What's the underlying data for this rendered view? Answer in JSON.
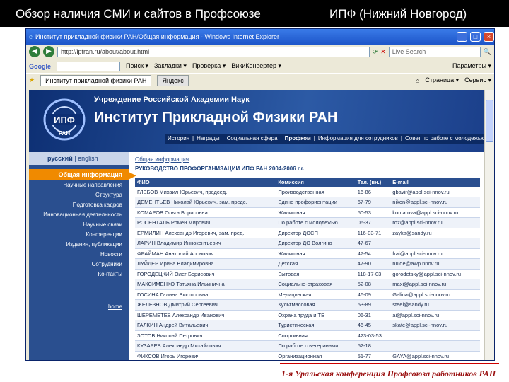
{
  "slide": {
    "title_left": "Обзор наличия СМИ и сайтов в Профсоюзе",
    "title_right": "ИПФ (Нижний Новгород)",
    "footer": "1-я Уральская конференция Профсоюза работников РАН"
  },
  "browser": {
    "window_title": "Институт прикладной физики РАН/Общая информация - Windows Internet Explorer",
    "url": "http://ipfran.ru/about/about.html",
    "live_search_placeholder": "Live Search",
    "google_label": "Google",
    "google_buttons": [
      "Поиск ▾",
      "Закладки ▾",
      "Проверка ▾",
      "ВикиКонвертер ▾"
    ],
    "settings_label": "Параметры ▾",
    "tabs": [
      "Институт прикладной физики РАН",
      "Яндекс"
    ],
    "tools": [
      "Страница ▾",
      "Сервис ▾"
    ]
  },
  "site": {
    "banner_sub": "Учреждение Российской Академии Наук",
    "banner_main": "Институт Прикладной Физики РАН",
    "top_menu": [
      "История",
      "Награды",
      "Социальная сфера",
      "Профком",
      "Информация для сотрудников",
      "Совет по работе с молодежью"
    ],
    "lang_ru": "русский",
    "lang_en": "english",
    "active_item": "Общая информация",
    "menu": [
      "Научные направления",
      "Структура",
      "Подготовка кадров",
      "Инновационная деятельность",
      "Научные связи",
      "Конференции",
      "Издания, публикации",
      "Новости",
      "Сотрудники",
      "Контакты"
    ],
    "home": "home",
    "breadcrumb": "Общая информация",
    "page_title": "РУКОВОДСТВО ПРОФОРГАНИЗАЦИИ ИПФ РАН 2004-2006 г.г.",
    "columns": [
      "ФИО",
      "Комиссия",
      "Тел. (вн.)",
      "E-mail"
    ],
    "rows": [
      [
        "ГЛЕБОВ Михаил Юрьевич, председ.",
        "Производственная",
        "16-86",
        "gbavir@appl.sci-nnov.ru"
      ],
      [
        "ДЕМЕНТЬЕВ Николай Юрьевич, зам. предс.",
        "Едино профориентации",
        "67-79",
        "nikon@appl.sci-nnov.ru"
      ],
      [
        "КОМАРОВ Ольга Борисовна",
        "Жилищная",
        "50-53",
        "komarova@appl.sci-nnov.ru"
      ],
      [
        "РОСЕНТАЛЬ Ромен Мирович",
        "По работе с молодежью",
        "06-37",
        "roz@appl.sci-nnov.ru"
      ],
      [
        "ЕРМИЛИН Александр Игоревич, зам. пред.",
        "Директор ДОСП",
        "116-03-71",
        "zayka@sandy.ru"
      ],
      [
        "ЛАРИН Владимир Иннокентьевич",
        "Директор ДО Волгино",
        "47-67",
        ""
      ],
      [
        "ФРАЙМАН Анатолий Аронович",
        "Жилищная",
        "47-54",
        "frai@appl.sci-nnov.ru"
      ],
      [
        "ЛУЙДЕР Ирина Владимировна",
        "Детская",
        "47-90",
        "nulde@awp.nnov.ru"
      ],
      [
        "ГОРОДЕЦКИЙ Олег Борисович",
        "Бытовая",
        "118-17-03",
        "gorodetsky@appl.sci-nnov.ru"
      ],
      [
        "МАКСИМЕНКО Татьяна Ильинична",
        "Социально-страховая",
        "52-08",
        "maxi@appl.sci-nnov.ru"
      ],
      [
        "ГОСИНА Галина Викторовна",
        "Медицинская",
        "46-09",
        "Galina@appl.sci-nnov.ru"
      ],
      [
        "ЖЕЛЕЗНОВ Дмитрий Сергеевич",
        "Культмассовая",
        "53-89",
        "steel@sandy.ru"
      ],
      [
        "ШЕРЕМЕТЕВ Александр Иванович",
        "Охрана труда и ТБ",
        "06-31",
        "ai@appl.sci-nnov.ru"
      ],
      [
        "ГАЛКИН Андрей Витальевич",
        "Туристическая",
        "46-45",
        "skate@appl.sci-nnov.ru"
      ],
      [
        "ЗОТОВ Николай Петрович",
        "Спортивная",
        "423-03-53",
        ""
      ],
      [
        "КУЗАРЕВ Александр Михайлович",
        "По работе с ветеранами",
        "52-18",
        ""
      ],
      [
        "ФИКСОВ Игорь Игоревич",
        "Организационная",
        "51-77",
        "GAYA@appl.sci-nnov.ru"
      ]
    ]
  }
}
